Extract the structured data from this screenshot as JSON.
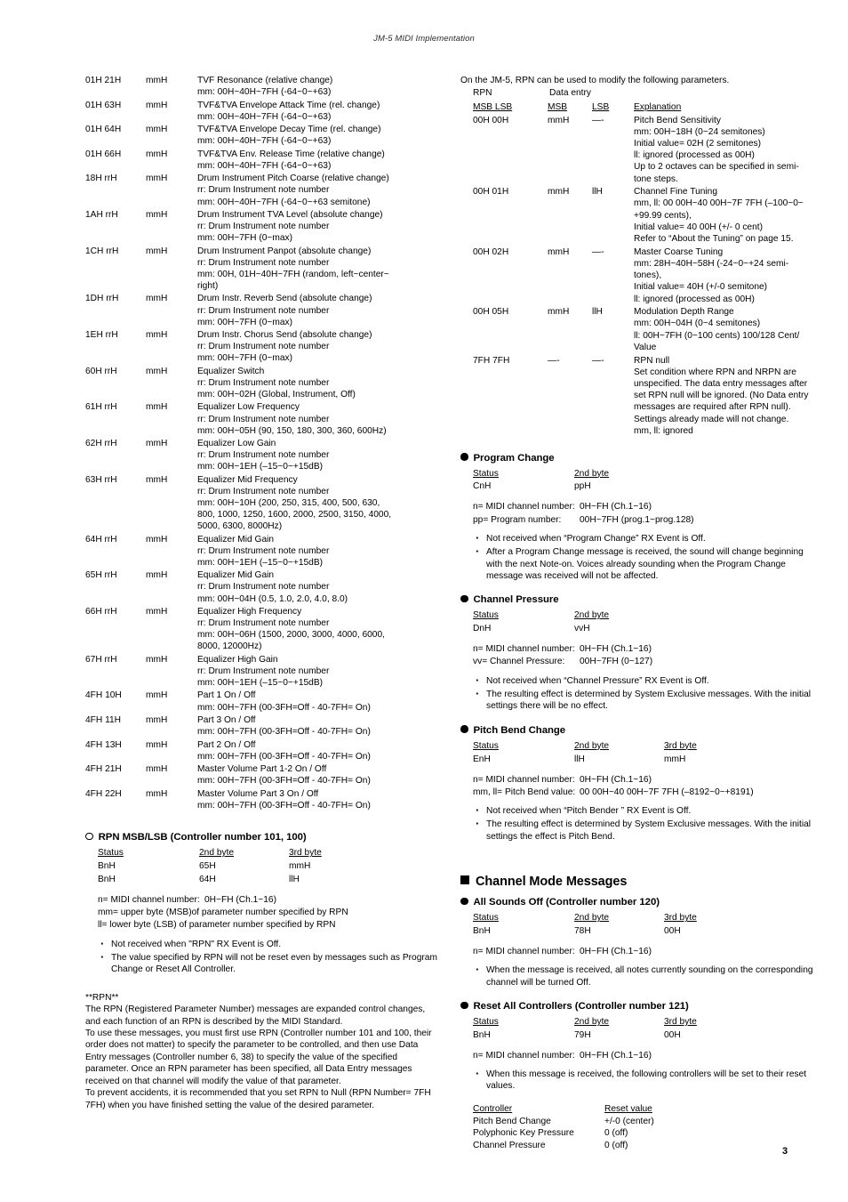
{
  "header": {
    "running_title": "JM-5 MIDI Implementation"
  },
  "page_number": "3",
  "left_column": {
    "param_rows": [
      {
        "address": "01H 21H",
        "value": "mmH",
        "desc": [
          "TVF Resonance (relative change)",
          "mm: 00H~40H~7FH (-64~0~+63)"
        ]
      },
      {
        "address": "01H 63H",
        "value": "mmH",
        "desc": [
          "TVF&TVA Envelope Attack Time (rel. change)",
          "mm: 00H~40H~7FH (-64~0~+63)"
        ]
      },
      {
        "address": "01H 64H",
        "value": "mmH",
        "desc": [
          "TVF&TVA Envelope Decay Time (rel. change)",
          "mm: 00H~40H~7FH (-64~0~+63)"
        ]
      },
      {
        "address": "01H 66H",
        "value": "mmH",
        "desc": [
          "TVF&TVA Env. Release Time (relative change)",
          "mm: 00H~40H~7FH (-64~0~+63)"
        ]
      },
      {
        "address": "18H rrH",
        "value": "mmH",
        "desc": [
          "Drum Instrument Pitch Coarse (relative change)",
          "rr: Drum Instrument note number",
          "mm: 00H~40H~7FH (-64~0~+63 semitone)"
        ]
      },
      {
        "address": "1AH rrH",
        "value": "mmH",
        "desc": [
          "Drum Instrument TVA Level (absolute change)",
          "rr: Drum Instrument note number",
          "mm: 00H~7FH (0~max)"
        ]
      },
      {
        "address": "1CH rrH",
        "value": "mmH",
        "desc": [
          "Drum Instrument Panpot (absolute change)",
          "rr: Drum Instrument note number",
          "mm: 00H, 01H~40H~7FH (random, left~center~",
          "right)"
        ]
      },
      {
        "address": "1DH rrH",
        "value": "mmH",
        "desc": [
          "Drum Instr. Reverb Send (absolute change)",
          "rr: Drum Instrument note number",
          "mm: 00H~7FH (0~max)"
        ]
      },
      {
        "address": "1EH rrH",
        "value": "mmH",
        "desc": [
          "Drum Instr. Chorus Send (absolute change)",
          "rr: Drum Instrument note number",
          "mm: 00H~7FH (0~max)"
        ]
      },
      {
        "address": "60H rrH",
        "value": "mmH",
        "desc": [
          "Equalizer Switch",
          "rr: Drum Instrument note number",
          "mm: 00H~02H (Global, Instrument, Off)"
        ]
      },
      {
        "address": "61H rrH",
        "value": "mmH",
        "desc": [
          "Equalizer Low Frequency",
          "rr: Drum Instrument note number",
          "mm: 00H~05H (90, 150, 180, 300, 360, 600Hz)"
        ]
      },
      {
        "address": "62H rrH",
        "value": "mmH",
        "desc": [
          "Equalizer Low Gain",
          "rr: Drum Instrument note number",
          "mm: 00H~1EH (–15~0~+15dB)"
        ]
      },
      {
        "address": "63H rrH",
        "value": "mmH",
        "desc": [
          "Equalizer Mid Frequency",
          "rr: Drum Instrument note number",
          "mm: 00H~10H (200, 250, 315, 400, 500, 630,",
          "800, 1000, 1250, 1600, 2000, 2500, 3150, 4000,",
          "5000, 6300, 8000Hz)"
        ]
      },
      {
        "address": "64H rrH",
        "value": "mmH",
        "desc": [
          "Equalizer Mid Gain",
          "rr: Drum Instrument note number",
          "mm: 00H~1EH (–15~0~+15dB)"
        ]
      },
      {
        "address": "65H rrH",
        "value": "mmH",
        "desc": [
          "Equalizer Mid Gain",
          "rr: Drum Instrument note number",
          "mm: 00H~04H (0.5, 1.0, 2.0, 4.0, 8.0)"
        ]
      },
      {
        "address": "66H rrH",
        "value": "mmH",
        "desc": [
          "Equalizer High Frequency",
          "rr: Drum Instrument note number",
          "mm: 00H~06H (1500, 2000, 3000, 4000, 6000,",
          "8000, 12000Hz)"
        ]
      },
      {
        "address": "67H rrH",
        "value": "mmH",
        "desc": [
          "Equalizer High Gain",
          "rr: Drum Instrument note number",
          "mm: 00H~1EH (–15~0~+15dB)"
        ]
      },
      {
        "address": "4FH 10H",
        "value": "mmH",
        "desc": [
          "Part 1 On / Off",
          "mm: 00H~7FH (00-3FH=Off - 40-7FH= On)"
        ]
      },
      {
        "address": "4FH 11H",
        "value": "mmH",
        "desc": [
          "Part 3 On / Off",
          "mm: 00H~7FH (00-3FH=Off - 40-7FH= On)"
        ]
      },
      {
        "address": "4FH 13H",
        "value": "mmH",
        "desc": [
          "Part 2 On / Off",
          "mm: 00H~7FH (00-3FH=Off - 40-7FH= On)"
        ]
      },
      {
        "address": "4FH 21H",
        "value": "mmH",
        "desc": [
          "Master Volume Part 1-2 On / Off",
          "mm: 00H~7FH (00-3FH=Off - 40-7FH= On)"
        ]
      },
      {
        "address": "4FH 22H",
        "value": "mmH",
        "desc": [
          "Master Volume Part 3 On / Off",
          "mm: 00H~7FH (00-3FH=Off - 40-7FH= On)"
        ]
      }
    ],
    "rpn_section": {
      "heading": "RPN MSB/LSB (Controller number 101, 100)",
      "byte_headers": [
        "Status",
        "2nd byte",
        "3rd byte"
      ],
      "byte_rows": [
        [
          "BnH",
          "65H",
          "mmH"
        ],
        [
          "BnH",
          "64H",
          "llH"
        ]
      ],
      "defs": [
        [
          "n= MIDI channel number:",
          "0H~FH (Ch.1~16)"
        ],
        [
          "mm= upper byte (MSB)of parameter number specified by RPN",
          ""
        ],
        [
          "ll= lower byte (LSB) of parameter number specified by RPN",
          ""
        ]
      ],
      "bullets": [
        "Not received when \"RPN\" RX Event is Off.",
        "The value specified by RPN will not be reset even by messages such as Program Change or Reset All Controller."
      ]
    },
    "rpn_note": {
      "title": "**RPN**",
      "paragraphs": [
        "The RPN (Registered Parameter Number) messages are expanded control changes, and each function of an RPN is described by the MIDI Standard.",
        "To use these messages, you must first use RPN (Controller number 101 and 100, their order does not matter) to specify the parameter to be controlled, and then use Data Entry messages (Controller number 6, 38) to specify the value of the specified parameter. Once an RPN parameter has been specified, all Data Entry messages received on that channel will modify the value of that parameter.",
        "To prevent accidents, it is recommended that you set RPN to Null (RPN Number= 7FH 7FH) when you have finished setting the value of the desired parameter."
      ]
    }
  },
  "right_column": {
    "rpn_params": {
      "intro": "On the JM-5, RPN can be used to modify the following parameters.",
      "group_labels": [
        "RPN",
        "Data entry"
      ],
      "headers": [
        "MSB LSB",
        "MSB",
        "LSB",
        "Explanation"
      ],
      "rows": [
        {
          "msblsb": "00H 00H",
          "msb": "mmH",
          "lsb": "—-",
          "explanation": [
            "Pitch Bend Sensitivity",
            "mm: 00H~18H (0~24 semitones)",
            "Initial value= 02H (2 semitones)",
            "ll: ignored (processed as 00H)",
            "Up to 2 octaves can be specified in semi-",
            "tone steps."
          ]
        },
        {
          "msblsb": "00H 01H",
          "msb": "mmH",
          "lsb": "llH",
          "explanation": [
            "Channel Fine Tuning",
            "mm, ll: 00 00H~40 00H~7F 7FH (–100~0~",
            "+99.99 cents),",
            "Initial value= 40 00H (+/- 0 cent)",
            "Refer to “About the Tuning” on page 15."
          ]
        },
        {
          "msblsb": "00H 02H",
          "msb": "mmH",
          "lsb": "—-",
          "explanation": [
            "Master Coarse Tuning",
            "mm: 28H~40H~58H (-24~0~+24 semi-",
            "tones),",
            "Initial value= 40H (+/-0 semitone)",
            "ll: ignored (processed as 00H)"
          ]
        },
        {
          "msblsb": "00H 05H",
          "msb": "mmH",
          "lsb": "llH",
          "explanation": [
            "Modulation Depth Range",
            "mm: 00H~04H (0~4 semitones)",
            "ll: 00H~7FH (0~100 cents) 100/128 Cent/",
            "Value"
          ]
        },
        {
          "msblsb": "7FH 7FH",
          "msb": "—-",
          "lsb": "—-",
          "explanation": [
            "RPN null",
            "Set condition where RPN and NRPN are",
            "unspecified. The data entry messages after",
            "set RPN null will be ignored. (No Data entry",
            "messages are required after RPN null).",
            "Settings already made will not change.",
            "mm, ll: ignored"
          ]
        }
      ]
    },
    "program_change": {
      "heading": "Program Change",
      "byte_headers": [
        "Status",
        "2nd byte"
      ],
      "byte_rows": [
        [
          "CnH",
          "ppH"
        ]
      ],
      "defs": [
        [
          "n= MIDI channel number:",
          "0H~FH (Ch.1~16)"
        ],
        [
          "pp= Program number:",
          "00H~7FH (prog.1~prog.128)"
        ]
      ],
      "bullets": [
        "Not received when “Program Change” RX Event is Off.",
        "After a Program Change message is received, the sound will change beginning with the next Note-on. Voices already sounding when the Program Change message was received will not be affected."
      ]
    },
    "channel_pressure": {
      "heading": "Channel Pressure",
      "byte_headers": [
        "Status",
        "2nd byte"
      ],
      "byte_rows": [
        [
          "DnH",
          "vvH"
        ]
      ],
      "defs": [
        [
          "n= MIDI channel number:",
          "0H~FH (Ch.1~16)"
        ],
        [
          "vv= Channel Pressure:",
          "00H~7FH (0~127)"
        ]
      ],
      "bullets": [
        "Not received when “Channel Pressure” RX Event is Off.",
        "The resulting effect is determined by System Exclusive messages. With the initial settings there will be no effect."
      ]
    },
    "pitch_bend_change": {
      "heading": "Pitch Bend Change",
      "byte_headers": [
        "Status",
        "2nd byte",
        "3rd byte"
      ],
      "byte_rows": [
        [
          "EnH",
          "llH",
          "mmH"
        ]
      ],
      "defs": [
        [
          "n= MIDI channel number:",
          "0H~FH (Ch.1~16)"
        ],
        [
          "mm, ll= Pitch Bend value:",
          "00 00H~40 00H~7F 7FH (–8192~0~+8191)"
        ]
      ],
      "bullets": [
        "Not received when “Pitch Bender ” RX Event is Off.",
        "The resulting effect is determined by System Exclusive messages. With the initial settings the effect is Pitch Bend."
      ]
    },
    "channel_mode_messages": {
      "heading": "Channel Mode Messages",
      "all_sounds_off": {
        "heading": "All Sounds Off (Controller number 120)",
        "byte_headers": [
          "Status",
          "2nd byte",
          "3rd byte"
        ],
        "byte_rows": [
          [
            "BnH",
            "78H",
            "00H"
          ]
        ],
        "defs": [
          [
            "n= MIDI channel number:",
            "0H~FH (Ch.1~16)"
          ]
        ],
        "bullets": [
          "When the message is received, all notes currently sounding on the corresponding channel will be turned Off."
        ]
      },
      "reset_all_controllers": {
        "heading": "Reset All Controllers (Controller number 121)",
        "byte_headers": [
          "Status",
          "2nd byte",
          "3rd byte"
        ],
        "byte_rows": [
          [
            "BnH",
            "79H",
            "00H"
          ]
        ],
        "defs": [
          [
            "n= MIDI channel number:",
            "0H~FH (Ch.1~16)"
          ]
        ],
        "bullets": [
          "When this message is received, the following controllers will be set to their reset values."
        ],
        "reset_headers": [
          "Controller",
          "Reset value"
        ],
        "reset_rows": [
          [
            "Pitch Bend Change",
            "+/-0 (center)"
          ],
          [
            "Polyphonic Key Pressure",
            "0 (off)"
          ],
          [
            "Channel Pressure",
            "0 (off)"
          ]
        ]
      }
    }
  }
}
